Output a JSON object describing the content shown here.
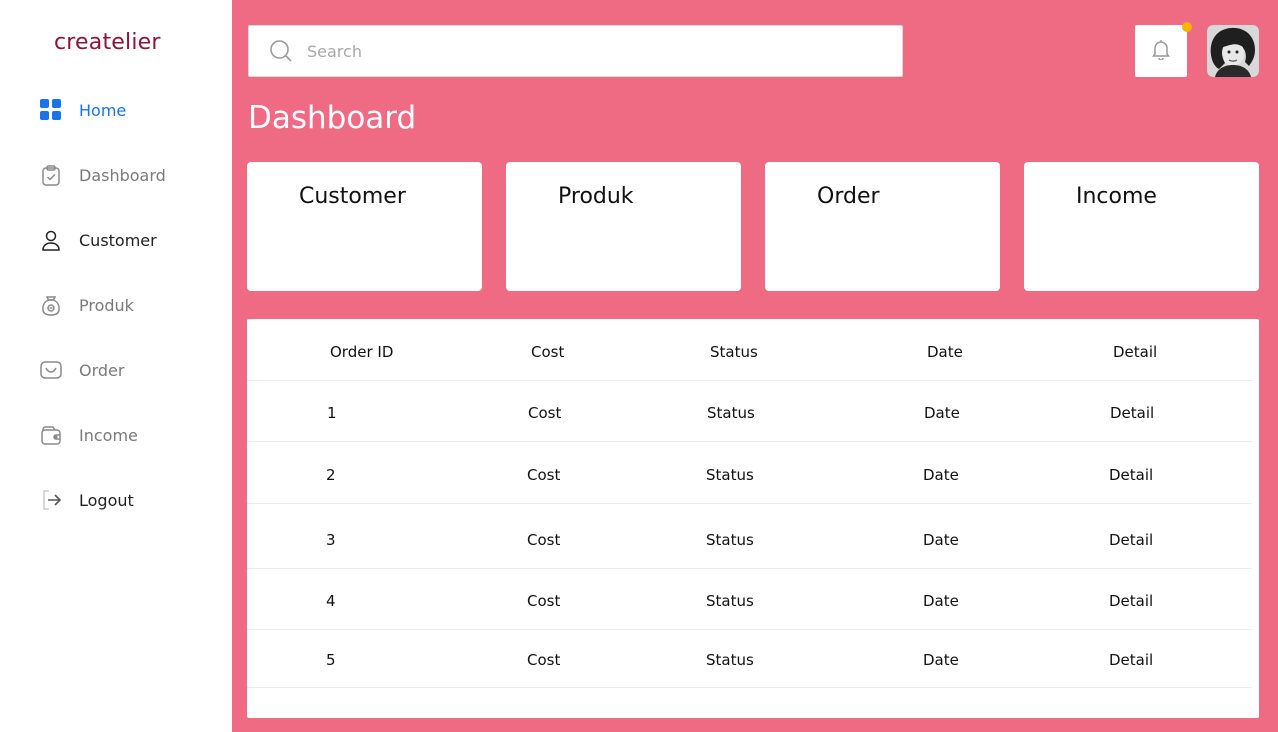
{
  "brand": "createlier",
  "nav": [
    {
      "label": "Home",
      "icon": "grid-icon"
    },
    {
      "label": "Dashboard",
      "icon": "clipboard-check-icon"
    },
    {
      "label": "Customer",
      "icon": "user-icon"
    },
    {
      "label": "Produk",
      "icon": "bag-icon"
    },
    {
      "label": "Order",
      "icon": "inbox-icon"
    },
    {
      "label": "Income",
      "icon": "wallet-icon"
    },
    {
      "label": "Logout",
      "icon": "logout-icon"
    }
  ],
  "search": {
    "placeholder": "Search"
  },
  "page_title": "Dashboard",
  "cards": [
    "Customer",
    "Produk",
    "Order",
    "Income"
  ],
  "table": {
    "headers": [
      "Order ID",
      "Cost",
      "Status",
      "Date",
      "Detail"
    ],
    "rows": [
      [
        "1",
        "Cost",
        "Status",
        "Date",
        "Detail"
      ],
      [
        "2",
        "Cost",
        "Status",
        "Date",
        "Detail"
      ],
      [
        "3",
        "Cost",
        "Status",
        "Date",
        "Detail"
      ],
      [
        "4",
        "Cost",
        "Status",
        "Date",
        "Detail"
      ],
      [
        "5",
        "Cost",
        "Status",
        "Date",
        "Detail"
      ]
    ]
  },
  "colors": {
    "background": "#ef6b84",
    "brand": "#8b1538",
    "active": "#1a73e8",
    "notification_dot": "#f7b500"
  }
}
